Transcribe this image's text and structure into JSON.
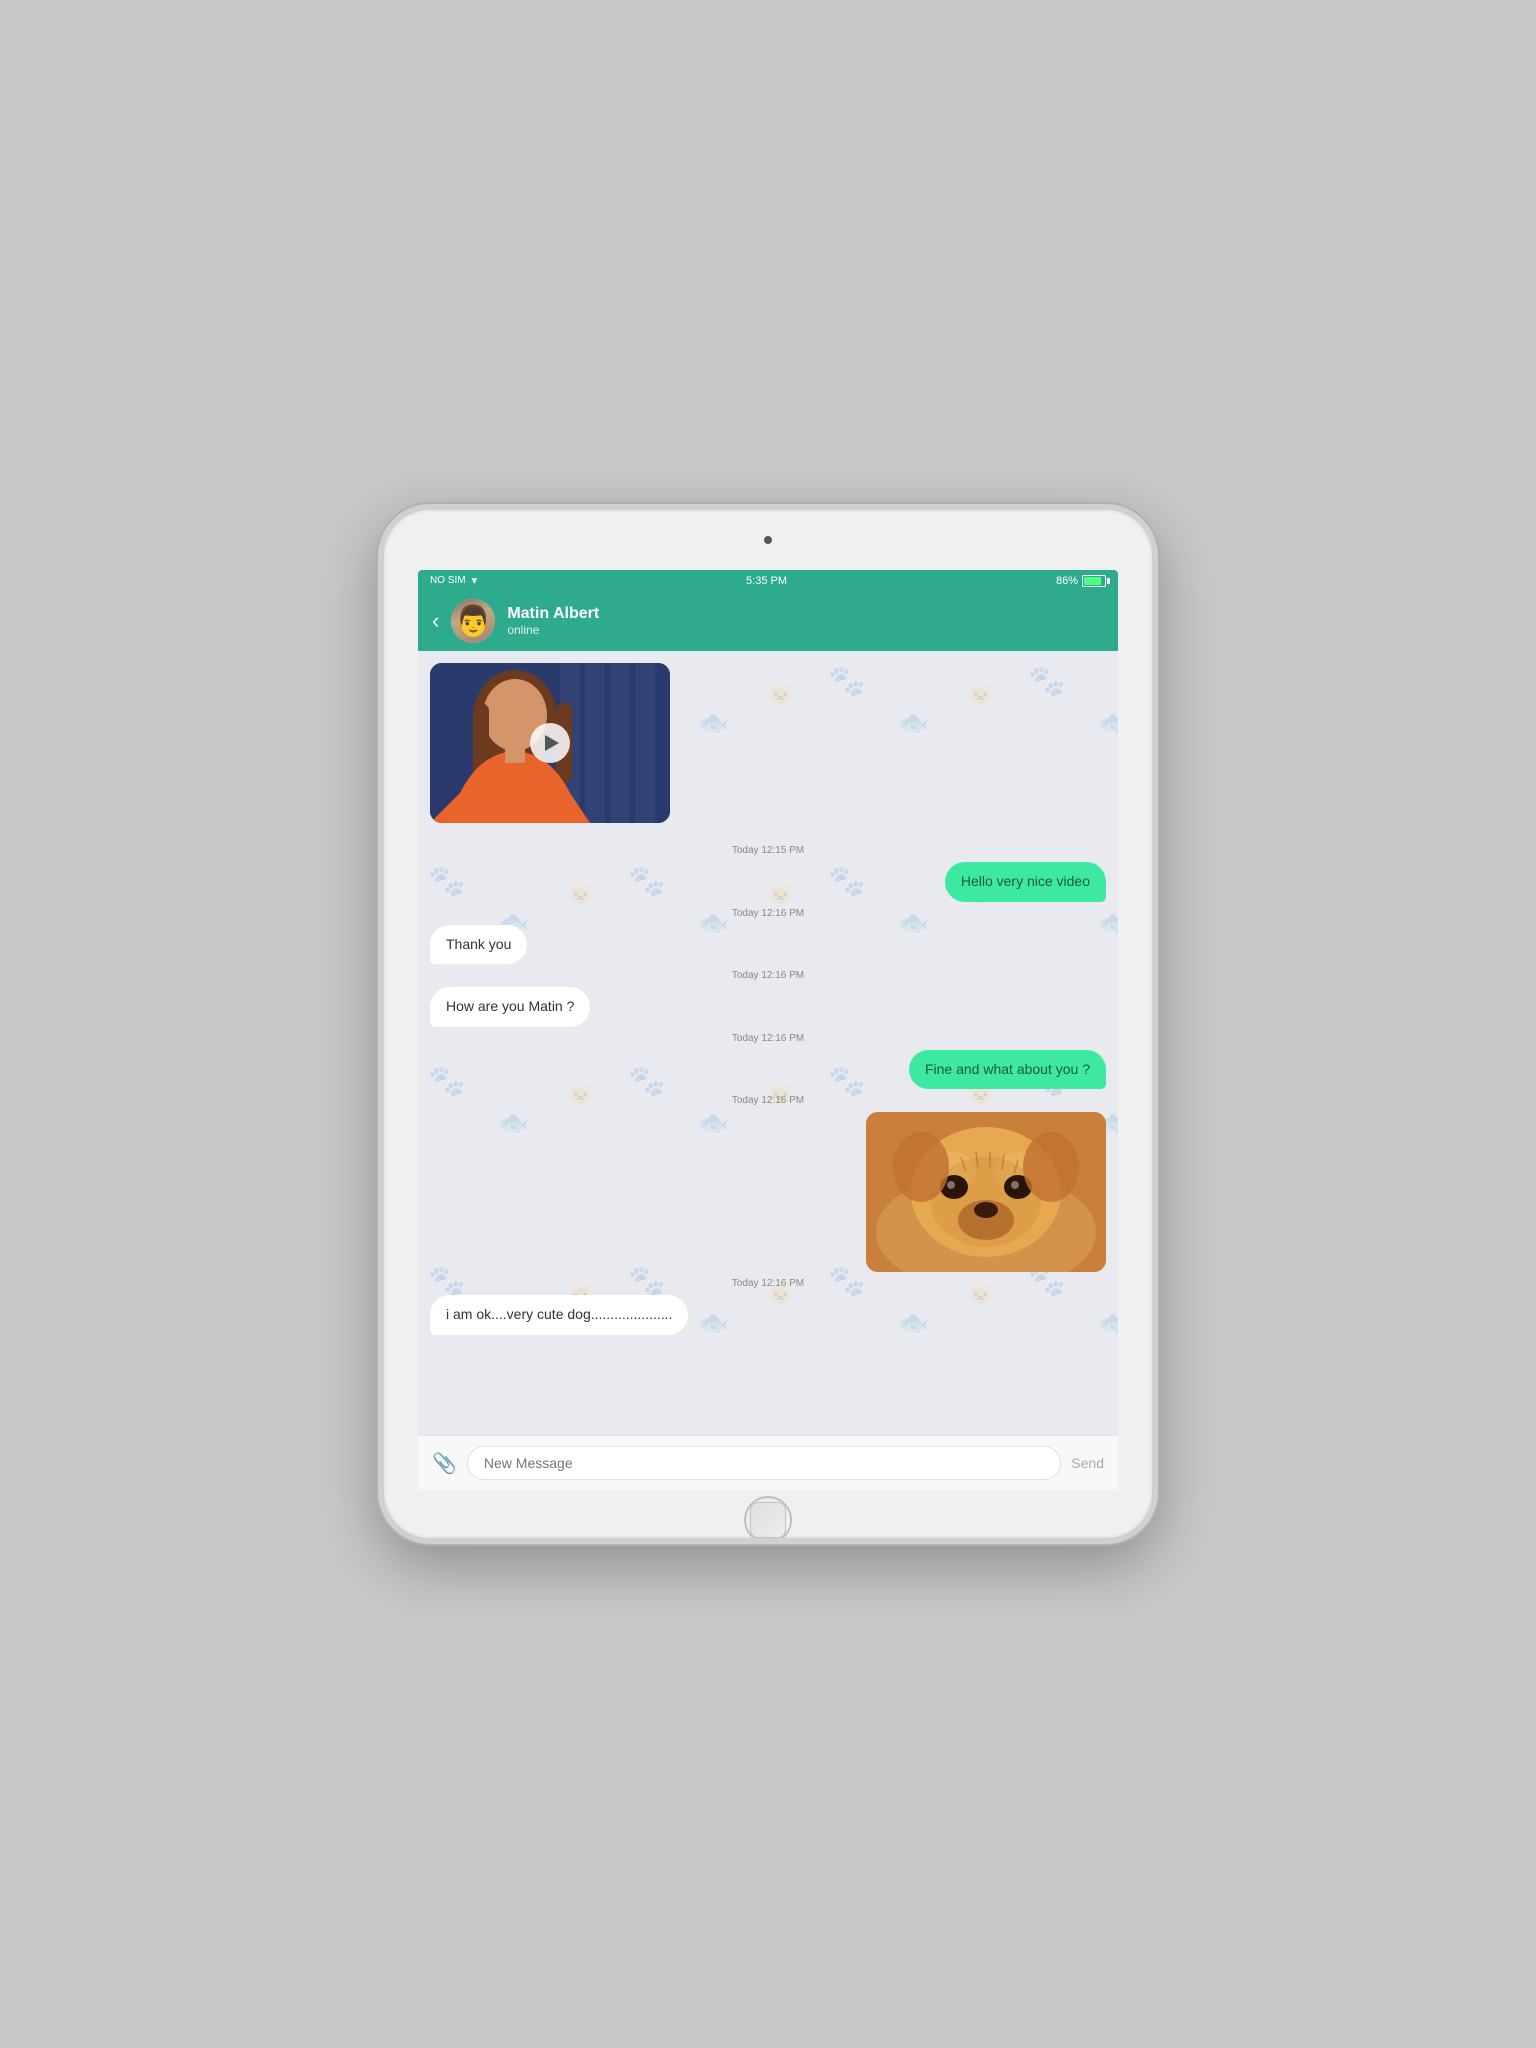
{
  "device": {
    "status_bar": {
      "left": "NO SIM",
      "wifi": "wifi",
      "time": "5:35 PM",
      "battery_percent": "86%"
    }
  },
  "header": {
    "back_label": "‹",
    "contact_name": "Matin Albert",
    "contact_status": "online"
  },
  "messages": [
    {
      "id": "video",
      "type": "video",
      "side": "left",
      "timestamp": null
    },
    {
      "id": "ts1",
      "type": "timestamp",
      "text": "Today 12:15 PM"
    },
    {
      "id": "msg1",
      "type": "text",
      "side": "right",
      "text": "Hello very nice video"
    },
    {
      "id": "ts2",
      "type": "timestamp",
      "text": "Today 12:16 PM"
    },
    {
      "id": "msg2",
      "type": "text",
      "side": "left",
      "text": "Thank you"
    },
    {
      "id": "ts3",
      "type": "timestamp",
      "text": "Today 12:16 PM"
    },
    {
      "id": "msg3",
      "type": "text",
      "side": "left",
      "text": "How are you Matin ?"
    },
    {
      "id": "ts4",
      "type": "timestamp",
      "text": "Today 12:16 PM"
    },
    {
      "id": "msg4",
      "type": "text",
      "side": "right",
      "text": "Fine and what about you ?"
    },
    {
      "id": "ts5",
      "type": "timestamp",
      "text": "Today 12:16 PM"
    },
    {
      "id": "img1",
      "type": "image",
      "side": "right",
      "alt": "cute dog photo"
    },
    {
      "id": "ts6",
      "type": "timestamp",
      "text": "Today 12:16 PM"
    },
    {
      "id": "msg5",
      "type": "text",
      "side": "left",
      "text": "i am ok....very cute dog....................."
    }
  ],
  "input": {
    "placeholder": "New Message",
    "send_label": "Send",
    "attach_label": "📎"
  },
  "colors": {
    "header_bg": "#2eab8c",
    "bubble_right": "#3de8a0",
    "bubble_left": "#ffffff",
    "chat_bg": "#e8eaf0"
  }
}
